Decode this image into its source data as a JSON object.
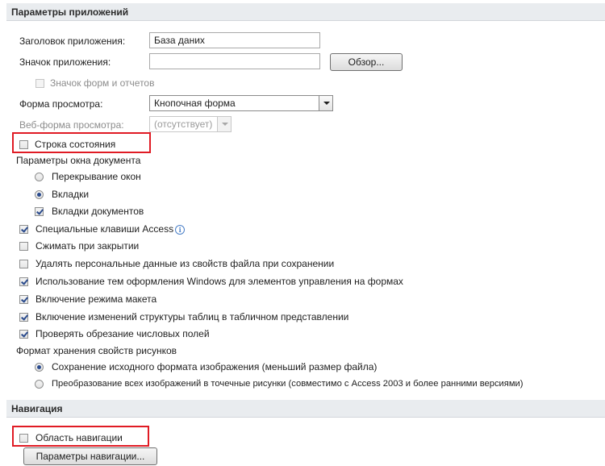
{
  "sections": {
    "app_params": "Параметры приложений",
    "navigation": "Навигация"
  },
  "app": {
    "title_label": "Заголовок приложения:",
    "title_value": "База даних",
    "icon_label": "Значок приложения:",
    "icon_value": "",
    "browse_button": "Обзор...",
    "forms_icon_label": "Значок форм и отчетов",
    "display_form_label": "Форма просмотра:",
    "display_form_value": "Кнопочная форма",
    "web_form_label": "Веб-форма просмотра:",
    "web_form_value": "(отсутствует)",
    "status_bar_label": "Строка состояния",
    "doc_window_options": "Параметры окна документа",
    "overlapping_windows": "Перекрывание окон",
    "tabbed_documents": "Вкладки",
    "document_tabs": "Вкладки документов",
    "special_keys": "Специальные клавиши Access",
    "compact_on_close": "Сжимать при закрытии",
    "remove_personal_info": "Удалять персональные данные из свойств файла при сохранении",
    "windows_themes": "Использование тем оформления Windows для элементов управления на формах",
    "layout_view": "Включение режима макета",
    "table_design_changes": "Включение изменений структуры таблиц в табличном представлении",
    "check_truncated_fields": "Проверять обрезание числовых полей",
    "picture_storage_label": "Формат хранения свойств рисунков",
    "preserve_source_format": "Сохранение исходного формата изображения (меньший размер файла)",
    "convert_to_bitmaps": "Преобразование всех изображений в точечные рисунки (совместимо с Access 2003 и более ранними версиями)"
  },
  "navigation": {
    "display_pane_label": "Область навигации",
    "options_button": "Параметры навигации..."
  },
  "state": {
    "forms_icon": false,
    "status_bar": false,
    "overlapping_windows": false,
    "tabbed_documents": true,
    "document_tabs": true,
    "special_keys": true,
    "compact_on_close": false,
    "remove_personal_info": false,
    "windows_themes": true,
    "layout_view": true,
    "table_design_changes": true,
    "check_truncated_fields": true,
    "preserve_source_format": true,
    "convert_to_bitmaps": false,
    "navigation_pane": false
  },
  "colors": {
    "highlight": "#e01b24",
    "section_header_bg": "#e9ecef"
  }
}
